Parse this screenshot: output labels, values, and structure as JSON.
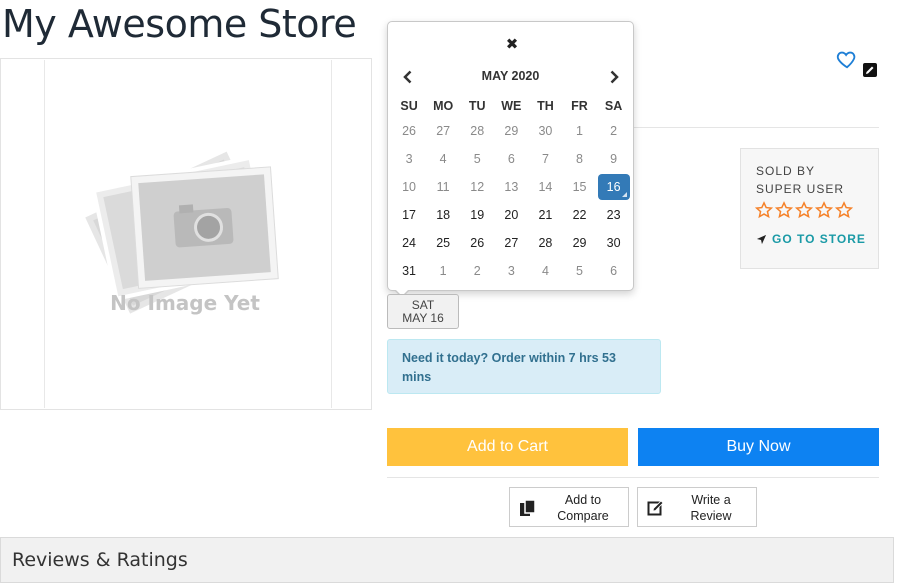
{
  "store": {
    "title": "My Awesome Store"
  },
  "product_image": {
    "placeholder_text": "No Image Yet",
    "icon": "camera-photos-icon"
  },
  "seller": {
    "sold_by_label": "SOLD BY",
    "seller_name": "SUPER USER",
    "rating": 0,
    "rating_max": 5,
    "go_to_store_label": "GO TO STORE",
    "accent_color": "#1a9aa6",
    "star_color": "#f5822a"
  },
  "calendar": {
    "month_label": "MAY 2020",
    "weekdays": [
      "SU",
      "MO",
      "TU",
      "WE",
      "TH",
      "FR",
      "SA"
    ],
    "selected_day": 16,
    "weeks": [
      [
        {
          "d": "26",
          "m": true
        },
        {
          "d": "27",
          "m": true
        },
        {
          "d": "28",
          "m": true
        },
        {
          "d": "29",
          "m": true
        },
        {
          "d": "30",
          "m": true
        },
        {
          "d": "1",
          "m": true
        },
        {
          "d": "2",
          "m": true
        }
      ],
      [
        {
          "d": "3",
          "m": true
        },
        {
          "d": "4",
          "m": true
        },
        {
          "d": "5",
          "m": true
        },
        {
          "d": "6",
          "m": true
        },
        {
          "d": "7",
          "m": true
        },
        {
          "d": "8",
          "m": true
        },
        {
          "d": "9",
          "m": true
        }
      ],
      [
        {
          "d": "10",
          "m": true
        },
        {
          "d": "11",
          "m": true
        },
        {
          "d": "12",
          "m": true
        },
        {
          "d": "13",
          "m": true
        },
        {
          "d": "14",
          "m": true
        },
        {
          "d": "15",
          "m": true
        },
        {
          "d": "16",
          "s": true
        }
      ],
      [
        {
          "d": "17"
        },
        {
          "d": "18"
        },
        {
          "d": "19"
        },
        {
          "d": "20"
        },
        {
          "d": "21"
        },
        {
          "d": "22"
        },
        {
          "d": "23"
        }
      ],
      [
        {
          "d": "24"
        },
        {
          "d": "25"
        },
        {
          "d": "26"
        },
        {
          "d": "27"
        },
        {
          "d": "28"
        },
        {
          "d": "29"
        },
        {
          "d": "30"
        }
      ],
      [
        {
          "d": "31"
        },
        {
          "d": "1",
          "m": true
        },
        {
          "d": "2",
          "m": true
        },
        {
          "d": "3",
          "m": true
        },
        {
          "d": "4",
          "m": true
        },
        {
          "d": "5",
          "m": true
        },
        {
          "d": "6",
          "m": true
        }
      ]
    ],
    "selected_color": "#337ab7"
  },
  "delivery": {
    "chip_day": "SAT",
    "chip_date": "MAY 16",
    "alert_text": "Need it today? Order within 7 hrs 53 mins"
  },
  "actions": {
    "add_to_cart": "Add to Cart",
    "buy_now": "Buy Now",
    "add_to_compare": "Add to\nCompare",
    "write_review": "Write a\nReview",
    "cart_color": "#ffc23d",
    "buy_color": "#0d82f2"
  },
  "reviews": {
    "title": "Reviews & Ratings"
  }
}
